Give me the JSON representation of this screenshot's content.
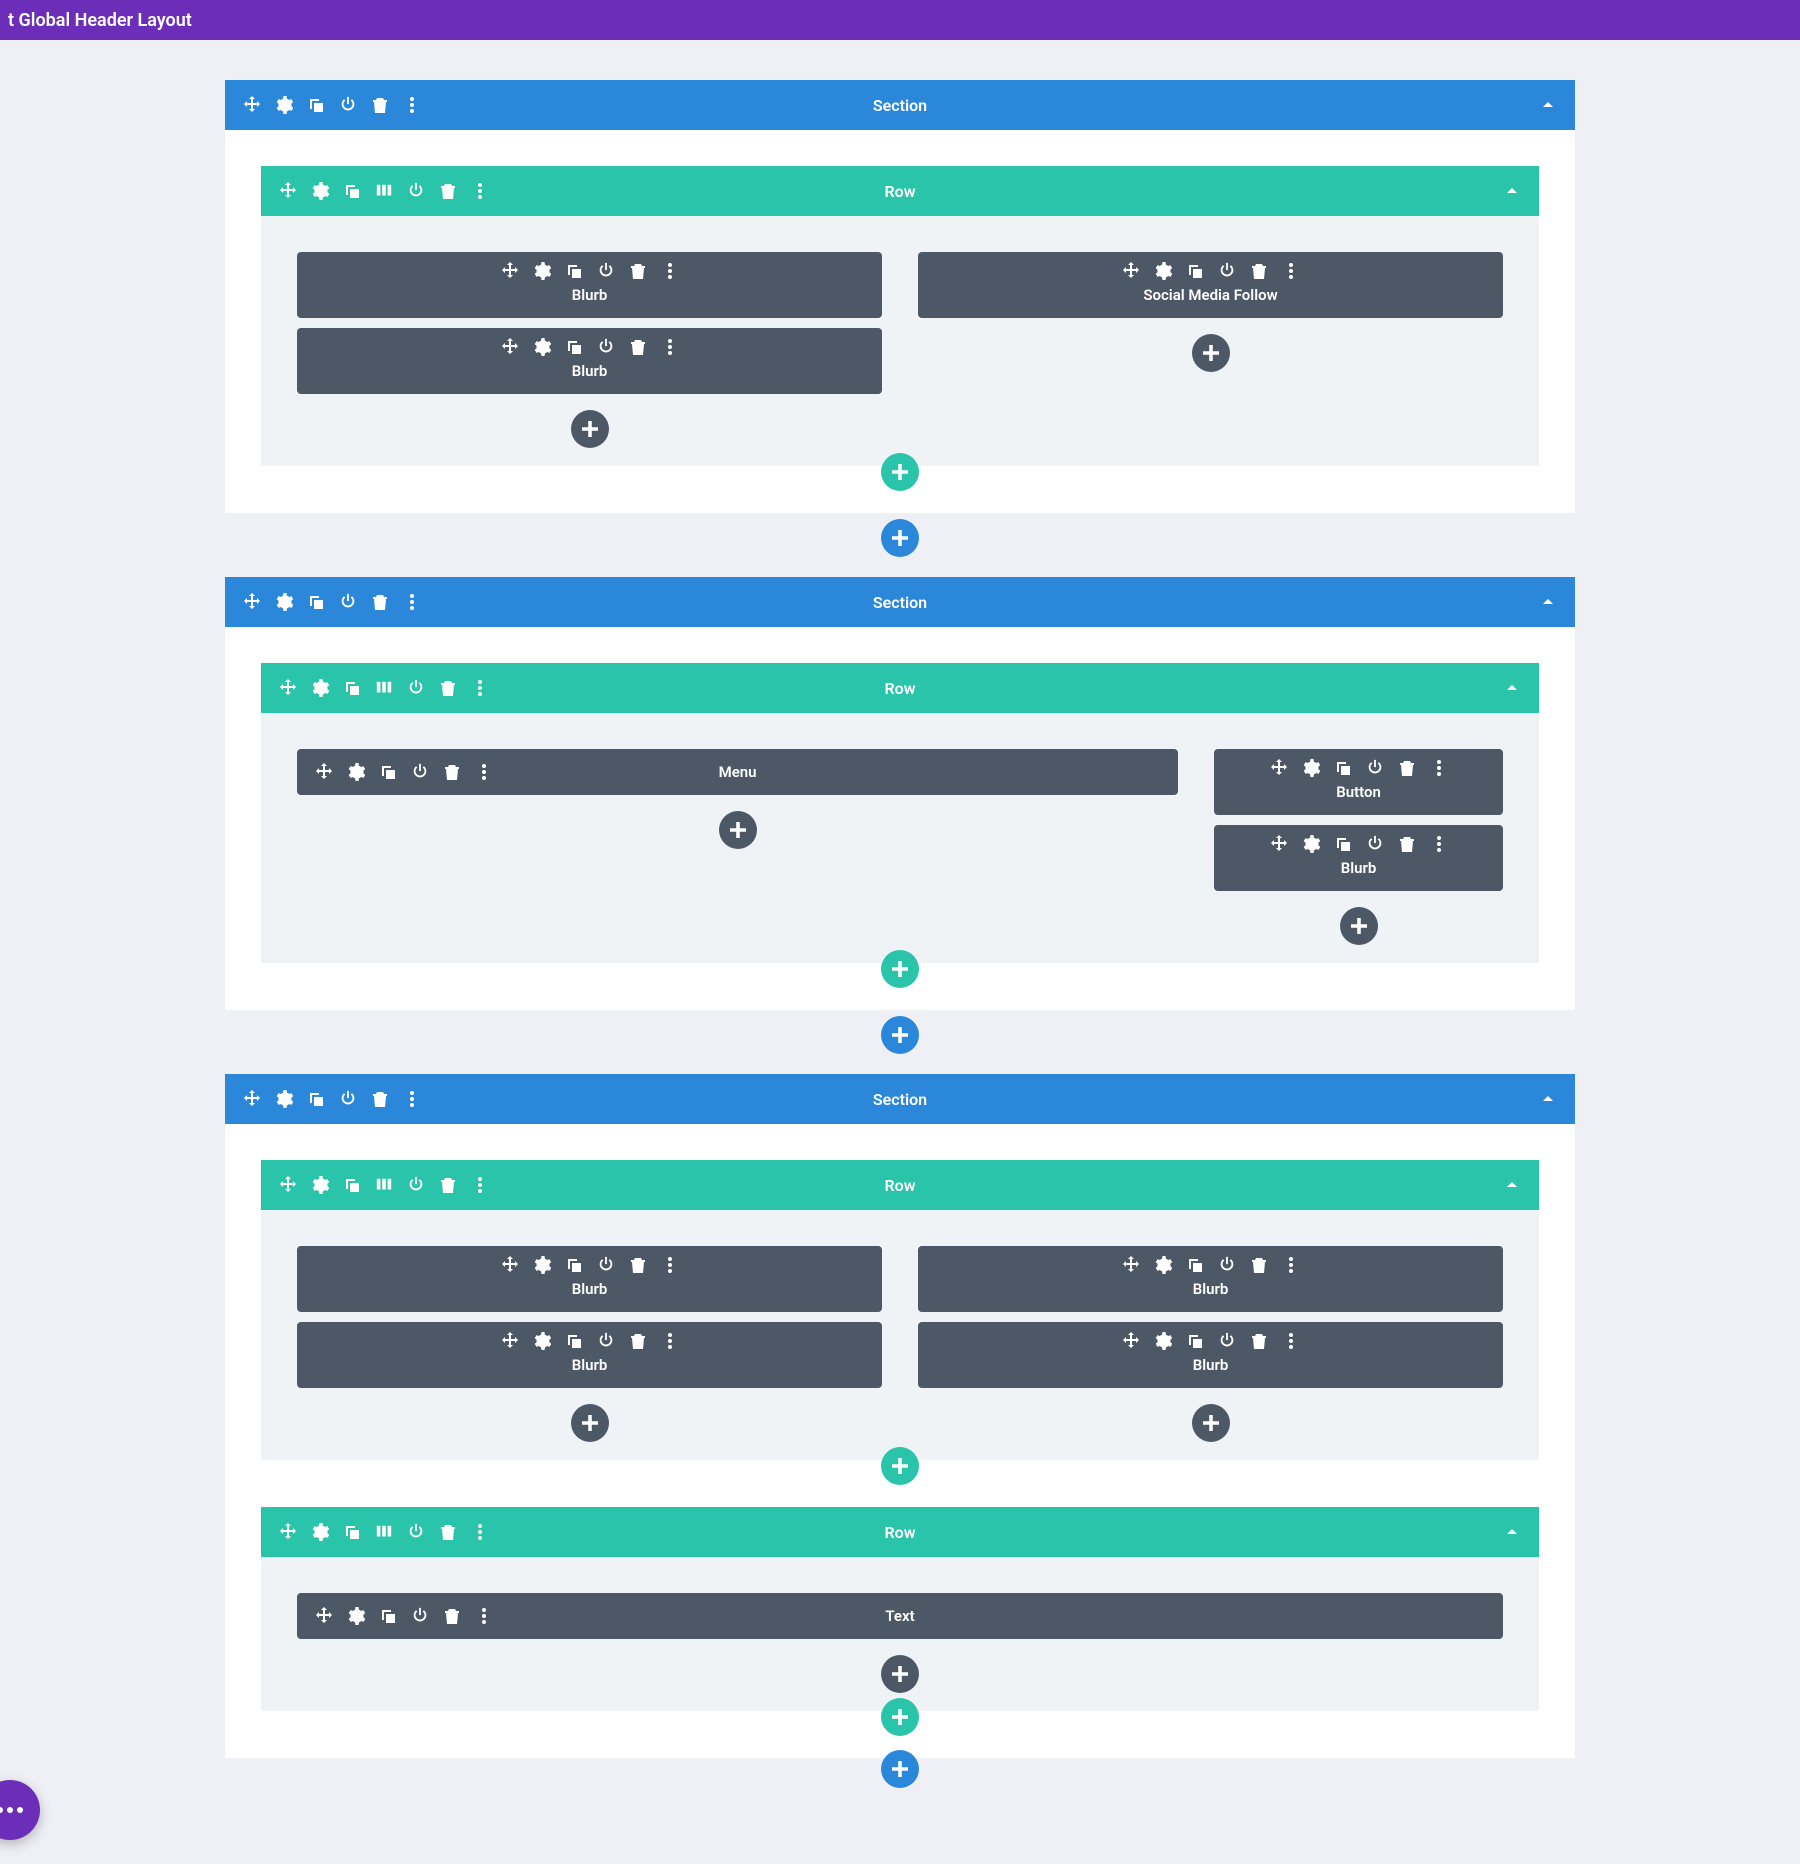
{
  "appbar": {
    "title": "t Global Header Layout"
  },
  "labels": {
    "section": "Section",
    "row": "Row",
    "blurb": "Blurb",
    "social": "Social Media Follow",
    "menu": "Menu",
    "button": "Button",
    "text": "Text"
  },
  "sections": [
    {
      "rows": [
        {
          "columns": [
            {
              "modules": [
                "blurb",
                "blurb"
              ]
            },
            {
              "modules": [
                "social"
              ]
            }
          ]
        }
      ]
    },
    {
      "rows": [
        {
          "layout": "wide-narrow",
          "columns": [
            {
              "modules": [
                "menu"
              ]
            },
            {
              "modules": [
                "button",
                "blurb"
              ]
            }
          ]
        }
      ]
    },
    {
      "rows": [
        {
          "columns": [
            {
              "modules": [
                "blurb",
                "blurb"
              ]
            },
            {
              "modules": [
                "blurb",
                "blurb"
              ]
            }
          ]
        },
        {
          "columns": [
            {
              "modules": [
                "text"
              ]
            }
          ]
        }
      ]
    }
  ]
}
